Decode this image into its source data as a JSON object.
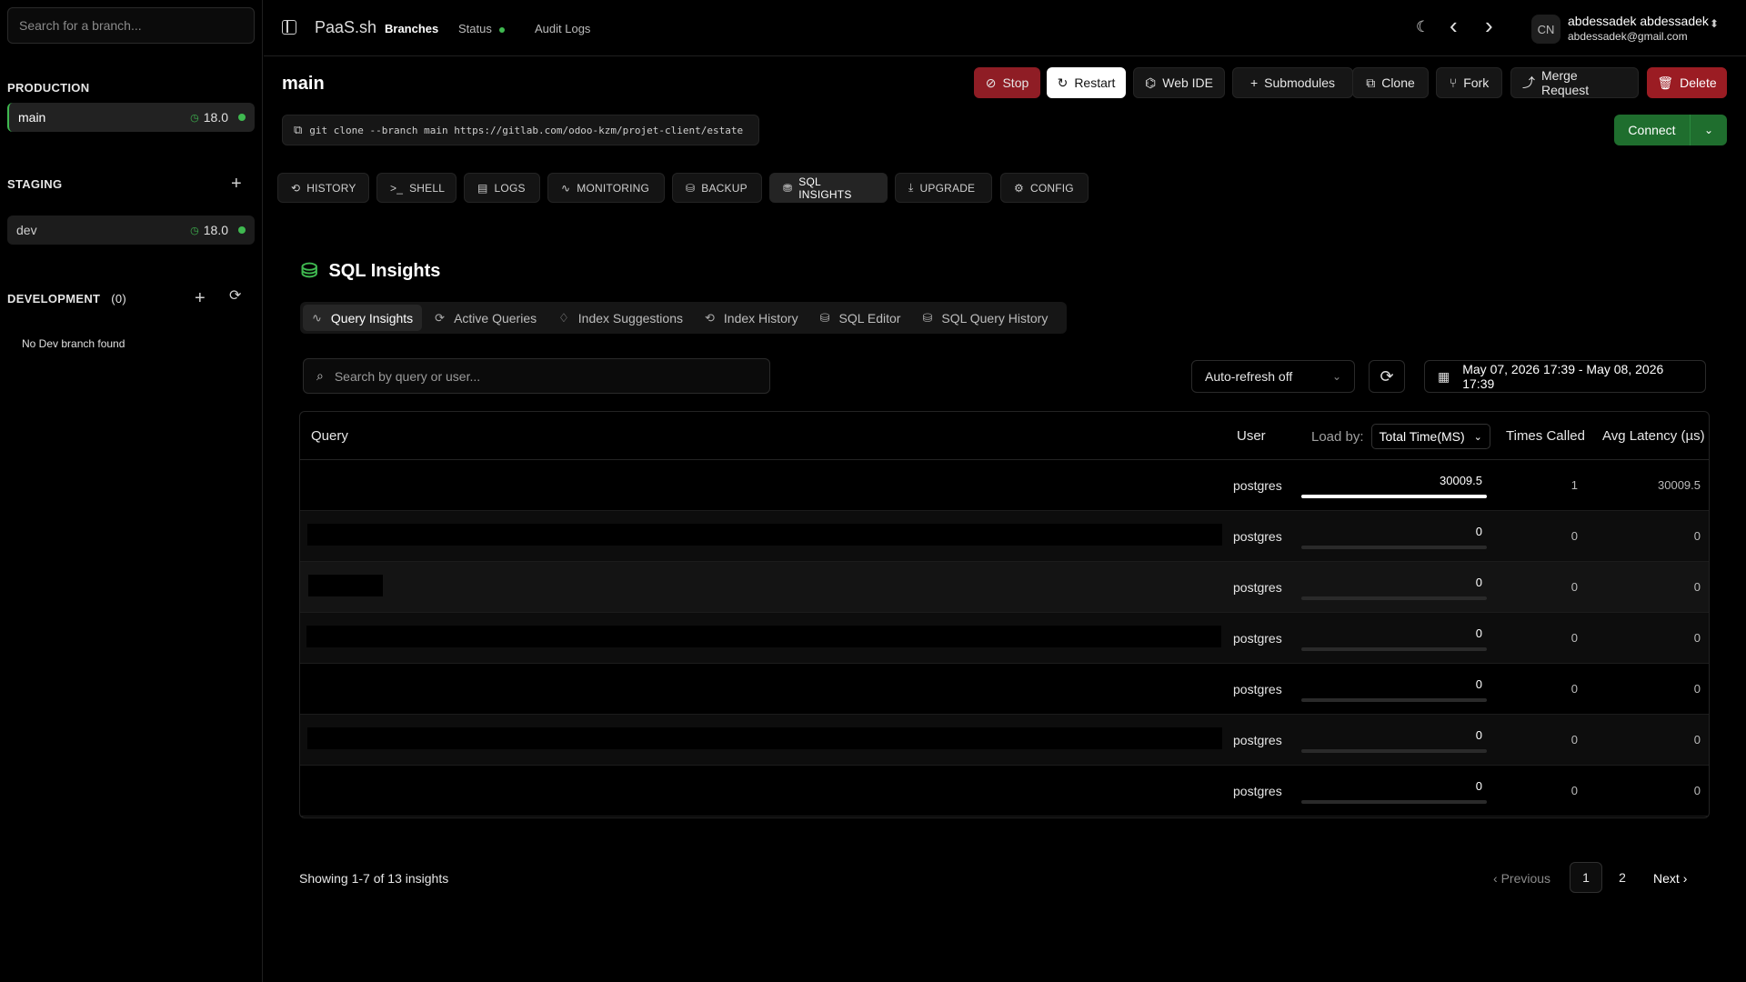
{
  "sidebar": {
    "search_placeholder": "Search for a branch...",
    "production": {
      "title": "PRODUCTION",
      "branches": [
        {
          "name": "main",
          "version": "18.0"
        }
      ]
    },
    "staging": {
      "title": "STAGING",
      "branches": [
        {
          "name": "dev",
          "version": "18.0"
        }
      ]
    },
    "development": {
      "title": "DEVELOPMENT",
      "count": "(0)",
      "empty": "No Dev branch found"
    }
  },
  "topbar": {
    "brand": "PaaS.sh",
    "nav": {
      "branches": "Branches",
      "status": "Status",
      "audit": "Audit Logs"
    },
    "user": {
      "initials": "CN",
      "name": "abdessadek abdessadek",
      "email": "abdessadek@gmail.com"
    }
  },
  "branch": {
    "title": "main",
    "clone_cmd": "git clone --branch main https://gitlab.com/odoo-kzm/projet-client/estate",
    "actions": {
      "stop": "Stop",
      "restart": "Restart",
      "web_ide": "Web IDE",
      "submodules": "Submodules",
      "clone": "Clone",
      "fork": "Fork",
      "merge": "Merge Request",
      "delete": "Delete"
    },
    "connect": "Connect"
  },
  "tabs": {
    "history": "HISTORY",
    "shell": "SHELL",
    "logs": "LOGS",
    "monitoring": "MONITORING",
    "backup": "BACKUP",
    "sql": "SQL INSIGHTS",
    "upgrade": "UPGRADE",
    "config": "CONFIG"
  },
  "insights": {
    "title": "SQL Insights",
    "subtabs": {
      "query": "Query Insights",
      "active": "Active Queries",
      "index_sugg": "Index Suggestions",
      "index_hist": "Index History",
      "editor": "SQL Editor",
      "history": "SQL Query History"
    },
    "search_placeholder": "Search by query or user...",
    "auto_refresh": "Auto-refresh off",
    "date_range": "May 07, 2026 17:39 - May 08, 2026 17:39",
    "columns": {
      "query": "Query",
      "user": "User",
      "load_by": "Load by:",
      "load_select": "Total Time(MS)",
      "times_called": "Times Called",
      "avg_latency": "Avg Latency (µs)"
    },
    "rows": [
      {
        "user": "postgres",
        "load": "30009.5",
        "load_fraction": 1.0,
        "calls": "1",
        "latency": "30009.5"
      },
      {
        "user": "postgres",
        "load": "0",
        "load_fraction": 0,
        "calls": "0",
        "latency": "0"
      },
      {
        "user": "postgres",
        "load": "0",
        "load_fraction": 0,
        "calls": "0",
        "latency": "0"
      },
      {
        "user": "postgres",
        "load": "0",
        "load_fraction": 0,
        "calls": "0",
        "latency": "0"
      },
      {
        "user": "postgres",
        "load": "0",
        "load_fraction": 0,
        "calls": "0",
        "latency": "0"
      },
      {
        "user": "postgres",
        "load": "0",
        "load_fraction": 0,
        "calls": "0",
        "latency": "0"
      },
      {
        "user": "postgres",
        "load": "0",
        "load_fraction": 0,
        "calls": "0",
        "latency": "0"
      }
    ],
    "pagination": {
      "showing": "Showing 1-7 of 13 insights",
      "previous": "Previous",
      "pages": [
        "1",
        "2"
      ],
      "next": "Next"
    }
  },
  "colors": {
    "accent_green": "#3fb950",
    "danger": "#9b1c23",
    "connect": "#1f6e2e"
  }
}
